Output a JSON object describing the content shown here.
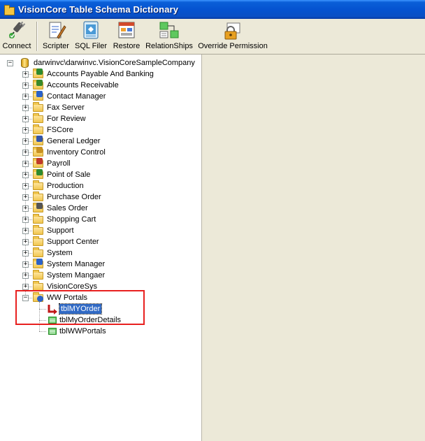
{
  "window": {
    "title": "VisionCore Table Schema Dictionary"
  },
  "toolbar": {
    "connect": "Connect",
    "scripter": "Scripter",
    "sql_filer": "SQL Filer",
    "restore": "Restore",
    "relationships": "RelationShips",
    "override_permission": "Override Permission"
  },
  "tree": {
    "root": {
      "label": "darwinvc\\darwinvc.VisionCoreSampleCompany",
      "expanded": true
    },
    "folders": [
      {
        "label": "Accounts Payable And Banking",
        "icon": "folder-dollar-icon"
      },
      {
        "label": "Accounts Receivable",
        "icon": "folder-receivable-icon"
      },
      {
        "label": "Contact Manager",
        "icon": "folder-contacts-icon"
      },
      {
        "label": "Fax Server",
        "icon": "folder-icon"
      },
      {
        "label": "For Review",
        "icon": "folder-icon"
      },
      {
        "label": "FSCore",
        "icon": "folder-icon"
      },
      {
        "label": "General Ledger",
        "icon": "folder-ledger-icon"
      },
      {
        "label": "Inventory Control",
        "icon": "folder-box-icon"
      },
      {
        "label": "Payroll",
        "icon": "folder-payroll-icon"
      },
      {
        "label": "Point of Sale",
        "icon": "folder-pos-icon"
      },
      {
        "label": "Production",
        "icon": "folder-icon"
      },
      {
        "label": "Purchase Order",
        "icon": "folder-icon"
      },
      {
        "label": "Sales Order",
        "icon": "folder-calculator-icon"
      },
      {
        "label": "Shopping Cart",
        "icon": "folder-icon"
      },
      {
        "label": "Support",
        "icon": "folder-icon"
      },
      {
        "label": "Support Center",
        "icon": "folder-icon"
      },
      {
        "label": "System",
        "icon": "folder-icon"
      },
      {
        "label": "System Manager",
        "icon": "folder-user-icon"
      },
      {
        "label": "System Mangaer",
        "icon": "folder-icon"
      },
      {
        "label": "VisionCoreSys",
        "icon": "folder-icon"
      }
    ],
    "ww_portals": {
      "label": "WW Portals",
      "expanded": true,
      "children": [
        {
          "label": "tblMYOrder",
          "selected": true,
          "icon": "table-arrow-icon"
        },
        {
          "label": "tblMyOrderDetails",
          "icon": "table-icon"
        },
        {
          "label": "tblWWPortals",
          "icon": "table-icon"
        }
      ]
    }
  },
  "colors": {
    "titlebar": "#0553d0",
    "selection": "#316ac5",
    "highlight_box": "#e8201f"
  }
}
